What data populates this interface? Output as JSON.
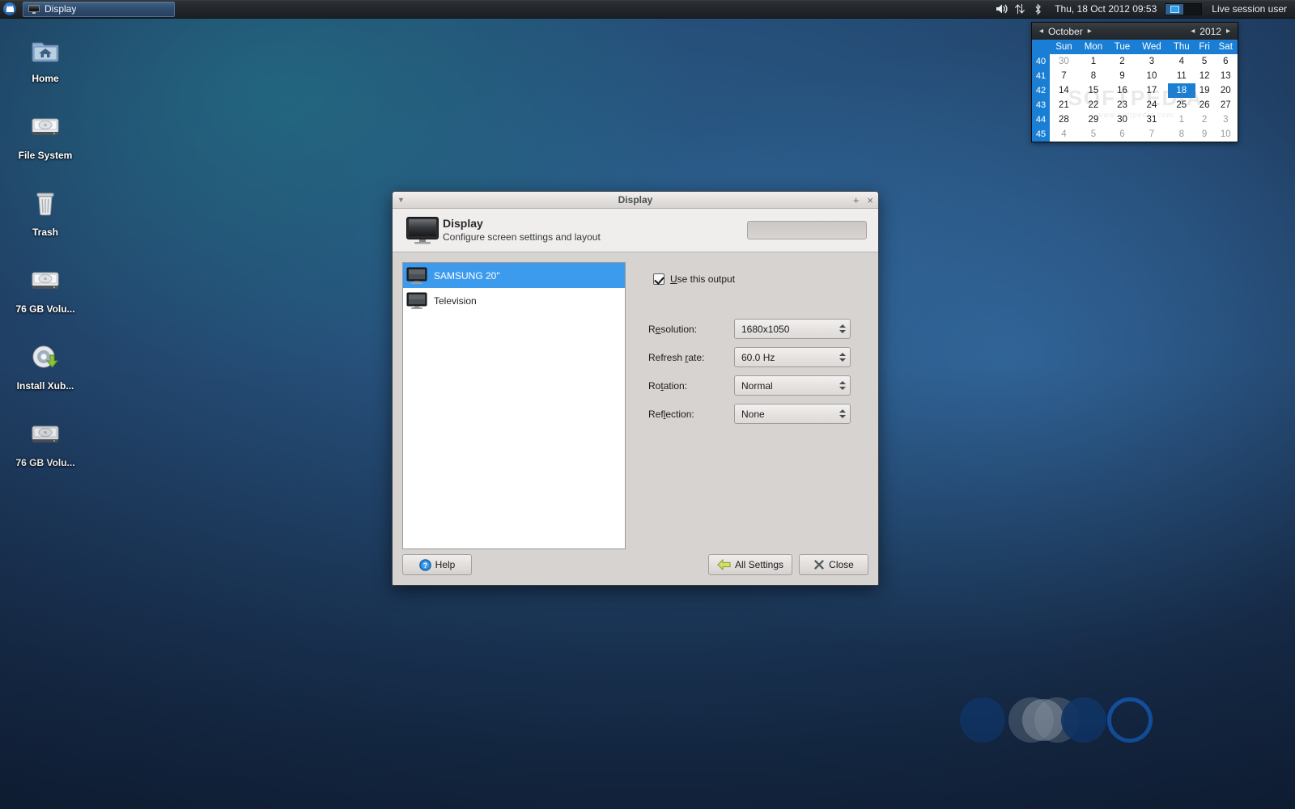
{
  "panel": {
    "menu_icon": "whisker-menu-icon",
    "task_button": {
      "label": "Display",
      "icon": "monitor-icon"
    },
    "tray": [
      {
        "name": "volume-icon",
        "glyph": "speaker"
      },
      {
        "name": "network-icon",
        "glyph": "up-down-arrows"
      },
      {
        "name": "bluetooth-icon",
        "glyph": "bluetooth"
      }
    ],
    "clock": "Thu, 18 Oct 2012 09:53",
    "workspaces": {
      "count": 2,
      "active_index": 0
    },
    "username": "Live session user"
  },
  "calendar": {
    "month": "October",
    "year": "2012",
    "prev_month_label": "◂",
    "next_month_label": "▸",
    "prev_year_label": "◂",
    "next_year_label": "▸",
    "weekday_headers": [
      "Sun",
      "Mon",
      "Tue",
      "Wed",
      "Thu",
      "Fri",
      "Sat"
    ],
    "week_numbers": [
      "40",
      "41",
      "42",
      "43",
      "44",
      "45"
    ],
    "weeks": [
      [
        {
          "d": "30",
          "o": true
        },
        {
          "d": "1"
        },
        {
          "d": "2"
        },
        {
          "d": "3"
        },
        {
          "d": "4"
        },
        {
          "d": "5"
        },
        {
          "d": "6"
        }
      ],
      [
        {
          "d": "7"
        },
        {
          "d": "8"
        },
        {
          "d": "9"
        },
        {
          "d": "10"
        },
        {
          "d": "11"
        },
        {
          "d": "12"
        },
        {
          "d": "13"
        }
      ],
      [
        {
          "d": "14"
        },
        {
          "d": "15"
        },
        {
          "d": "16"
        },
        {
          "d": "17"
        },
        {
          "d": "18",
          "today": true
        },
        {
          "d": "19"
        },
        {
          "d": "20"
        }
      ],
      [
        {
          "d": "21"
        },
        {
          "d": "22"
        },
        {
          "d": "23"
        },
        {
          "d": "24"
        },
        {
          "d": "25"
        },
        {
          "d": "26"
        },
        {
          "d": "27"
        }
      ],
      [
        {
          "d": "28"
        },
        {
          "d": "29"
        },
        {
          "d": "30"
        },
        {
          "d": "31"
        },
        {
          "d": "1",
          "o": true
        },
        {
          "d": "2",
          "o": true
        },
        {
          "d": "3",
          "o": true
        }
      ],
      [
        {
          "d": "4",
          "o": true
        },
        {
          "d": "5",
          "o": true
        },
        {
          "d": "6",
          "o": true
        },
        {
          "d": "7",
          "o": true
        },
        {
          "d": "8",
          "o": true
        },
        {
          "d": "9",
          "o": true
        },
        {
          "d": "10",
          "o": true
        }
      ]
    ],
    "watermark": "SOFTPEDIA",
    "watermark_sub": "www.softpedia.com"
  },
  "desktop": {
    "icons": [
      {
        "label": "Home",
        "icon": "home-folder-icon"
      },
      {
        "label": "File System",
        "icon": "hard-drive-icon"
      },
      {
        "label": "Trash",
        "icon": "trash-icon"
      },
      {
        "label": "76 GB Volu...",
        "icon": "hard-drive-icon"
      },
      {
        "label": "Install Xub...",
        "icon": "install-disc-icon"
      },
      {
        "label": "76 GB Volu...",
        "icon": "hard-drive-icon"
      }
    ]
  },
  "dialog": {
    "titlebar": {
      "title": "Display",
      "menu_button": "window-menu-icon",
      "maximize_button": "+",
      "close_button": "×"
    },
    "header": {
      "icon": "monitor-icon",
      "title": "Display",
      "subtitle": "Configure screen settings and layout",
      "search_value": "",
      "search_placeholder": "",
      "search_icon": "search-icon"
    },
    "outputs": [
      {
        "label": "SAMSUNG 20\"",
        "selected": true,
        "icon": "monitor-icon"
      },
      {
        "label": "Television",
        "selected": false,
        "icon": "monitor-icon"
      }
    ],
    "use_output": {
      "label": "Use this output",
      "checked": true
    },
    "properties": [
      {
        "label": "Resolution:",
        "value": "1680x1050"
      },
      {
        "label": "Refresh rate:",
        "value": "60.0 Hz"
      },
      {
        "label": "Rotation:",
        "value": "Normal"
      },
      {
        "label": "Reflection:",
        "value": "None"
      }
    ],
    "buttons": {
      "help": {
        "label": "Help",
        "icon": "help-icon"
      },
      "all_settings": {
        "label": "All Settings",
        "icon": "back-arrow-icon"
      },
      "close": {
        "label": "Close",
        "icon": "close-x-icon"
      }
    }
  },
  "colors": {
    "accent_blue": "#3d9bee",
    "calendar_header_blue": "#1a7fd4",
    "panel_dark": "#22262a",
    "dialog_bg": "#d6d3d1",
    "desktop_deep": "#15253f",
    "desktop_teal": "#1f5a6e"
  }
}
